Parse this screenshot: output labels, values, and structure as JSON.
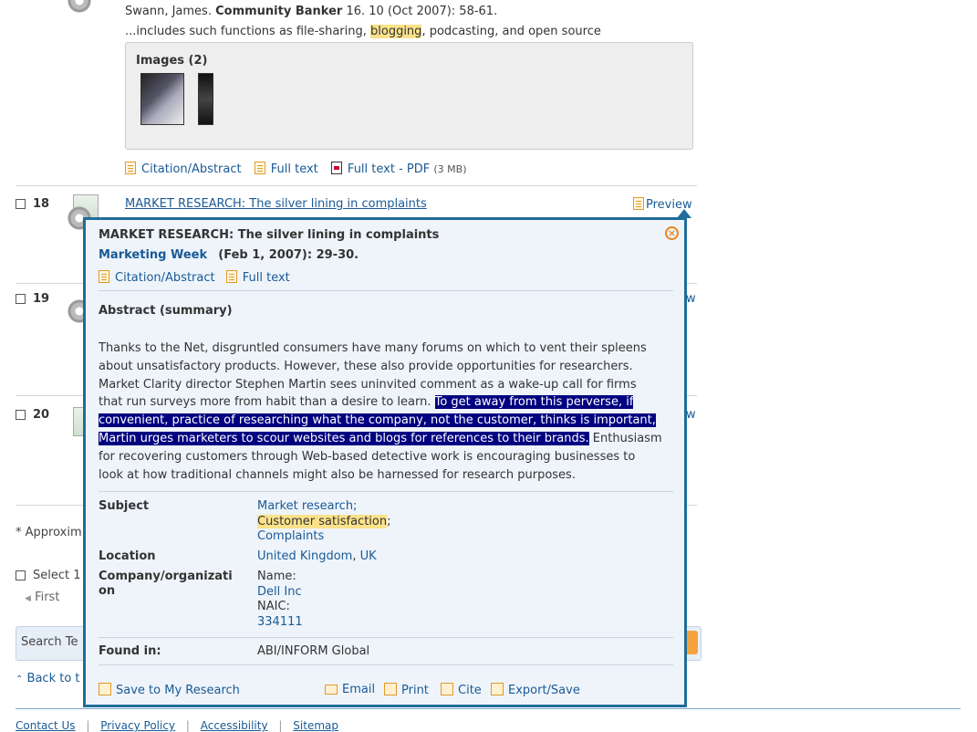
{
  "result17": {
    "author": "Swann, James.",
    "publication": "Community Banker",
    "details": "16. 10  (Oct 2007): 58-61.",
    "snippet_before": "...includes such functions as file-sharing, ",
    "snippet_highlight": "blogging",
    "snippet_after": ", podcasting, and open source",
    "images_label": "Images (2)",
    "links": {
      "citation": "Citation/Abstract",
      "fulltext": "Full text",
      "pdf": "Full text - PDF",
      "pdf_size": "(3 MB)"
    }
  },
  "result18": {
    "num": "18",
    "title": "MARKET RESEARCH: The silver lining in complaints",
    "preview": "Preview"
  },
  "result19": {
    "num": "19",
    "preview": "w"
  },
  "result20": {
    "num": "20",
    "preview": "w"
  },
  "footer_partial": {
    "approx": "* Approxim",
    "select": "Select 1",
    "first": "First",
    "search": "Search Te",
    "back": "Back to t",
    "links": [
      "Contact Us",
      "Privacy Policy",
      "Accessibility",
      "Sitemap"
    ]
  },
  "popup": {
    "title": "MARKET RESEARCH: The silver lining in complaints",
    "publication": "Marketing Week",
    "date": "(Feb 1, 2007): 29-30.",
    "citation": "Citation/Abstract",
    "fulltext": "Full text",
    "abstract_heading": "Abstract (summary)",
    "abstract_lines": [
      {
        "plain": "Thanks to the Net, disgruntled consumers have many forums on which to vent their spleens"
      },
      {
        "plain": "about unsatisfactory products. However, these also provide opportunities for researchers."
      },
      {
        "plain": "Market Clarity director Stephen Martin sees uninvited comment as a wake-up call for firms"
      },
      {
        "plain": "that run surveys more from habit than a desire to learn. ",
        "sel": "To get away from this perverse, if"
      },
      {
        "sel": "convenient, practice of researching what the company, not the customer, thinks is important,"
      },
      {
        "sel": "Martin urges marketers to scour websites and blogs for references to their brands.",
        "plain2": " Enthusiasm"
      },
      {
        "plain": "for recovering customers through Web-based detective work is encouraging businesses to"
      },
      {
        "plain": "look at how traditional channels might also be harnessed for research purposes."
      }
    ],
    "subject_label": "Subject",
    "subjects": [
      "Market research;",
      "Customer satisfaction",
      "Complaints"
    ],
    "subject_sep": ";",
    "location_label": "Location",
    "location_a": "United Kingdom",
    "location_b": "UK",
    "company_label_1": "Company/organizati",
    "company_label_2": "on",
    "name_label": "Name:",
    "company_name": "Dell Inc",
    "naic_label": "NAIC:",
    "naic_code": "334111",
    "found_label": "Found in:",
    "found_value": "ABI/INFORM Global",
    "actions": {
      "save": "Save to My Research",
      "email": "Email",
      "print": "Print",
      "cite": "Cite",
      "export": "Export/Save"
    }
  }
}
